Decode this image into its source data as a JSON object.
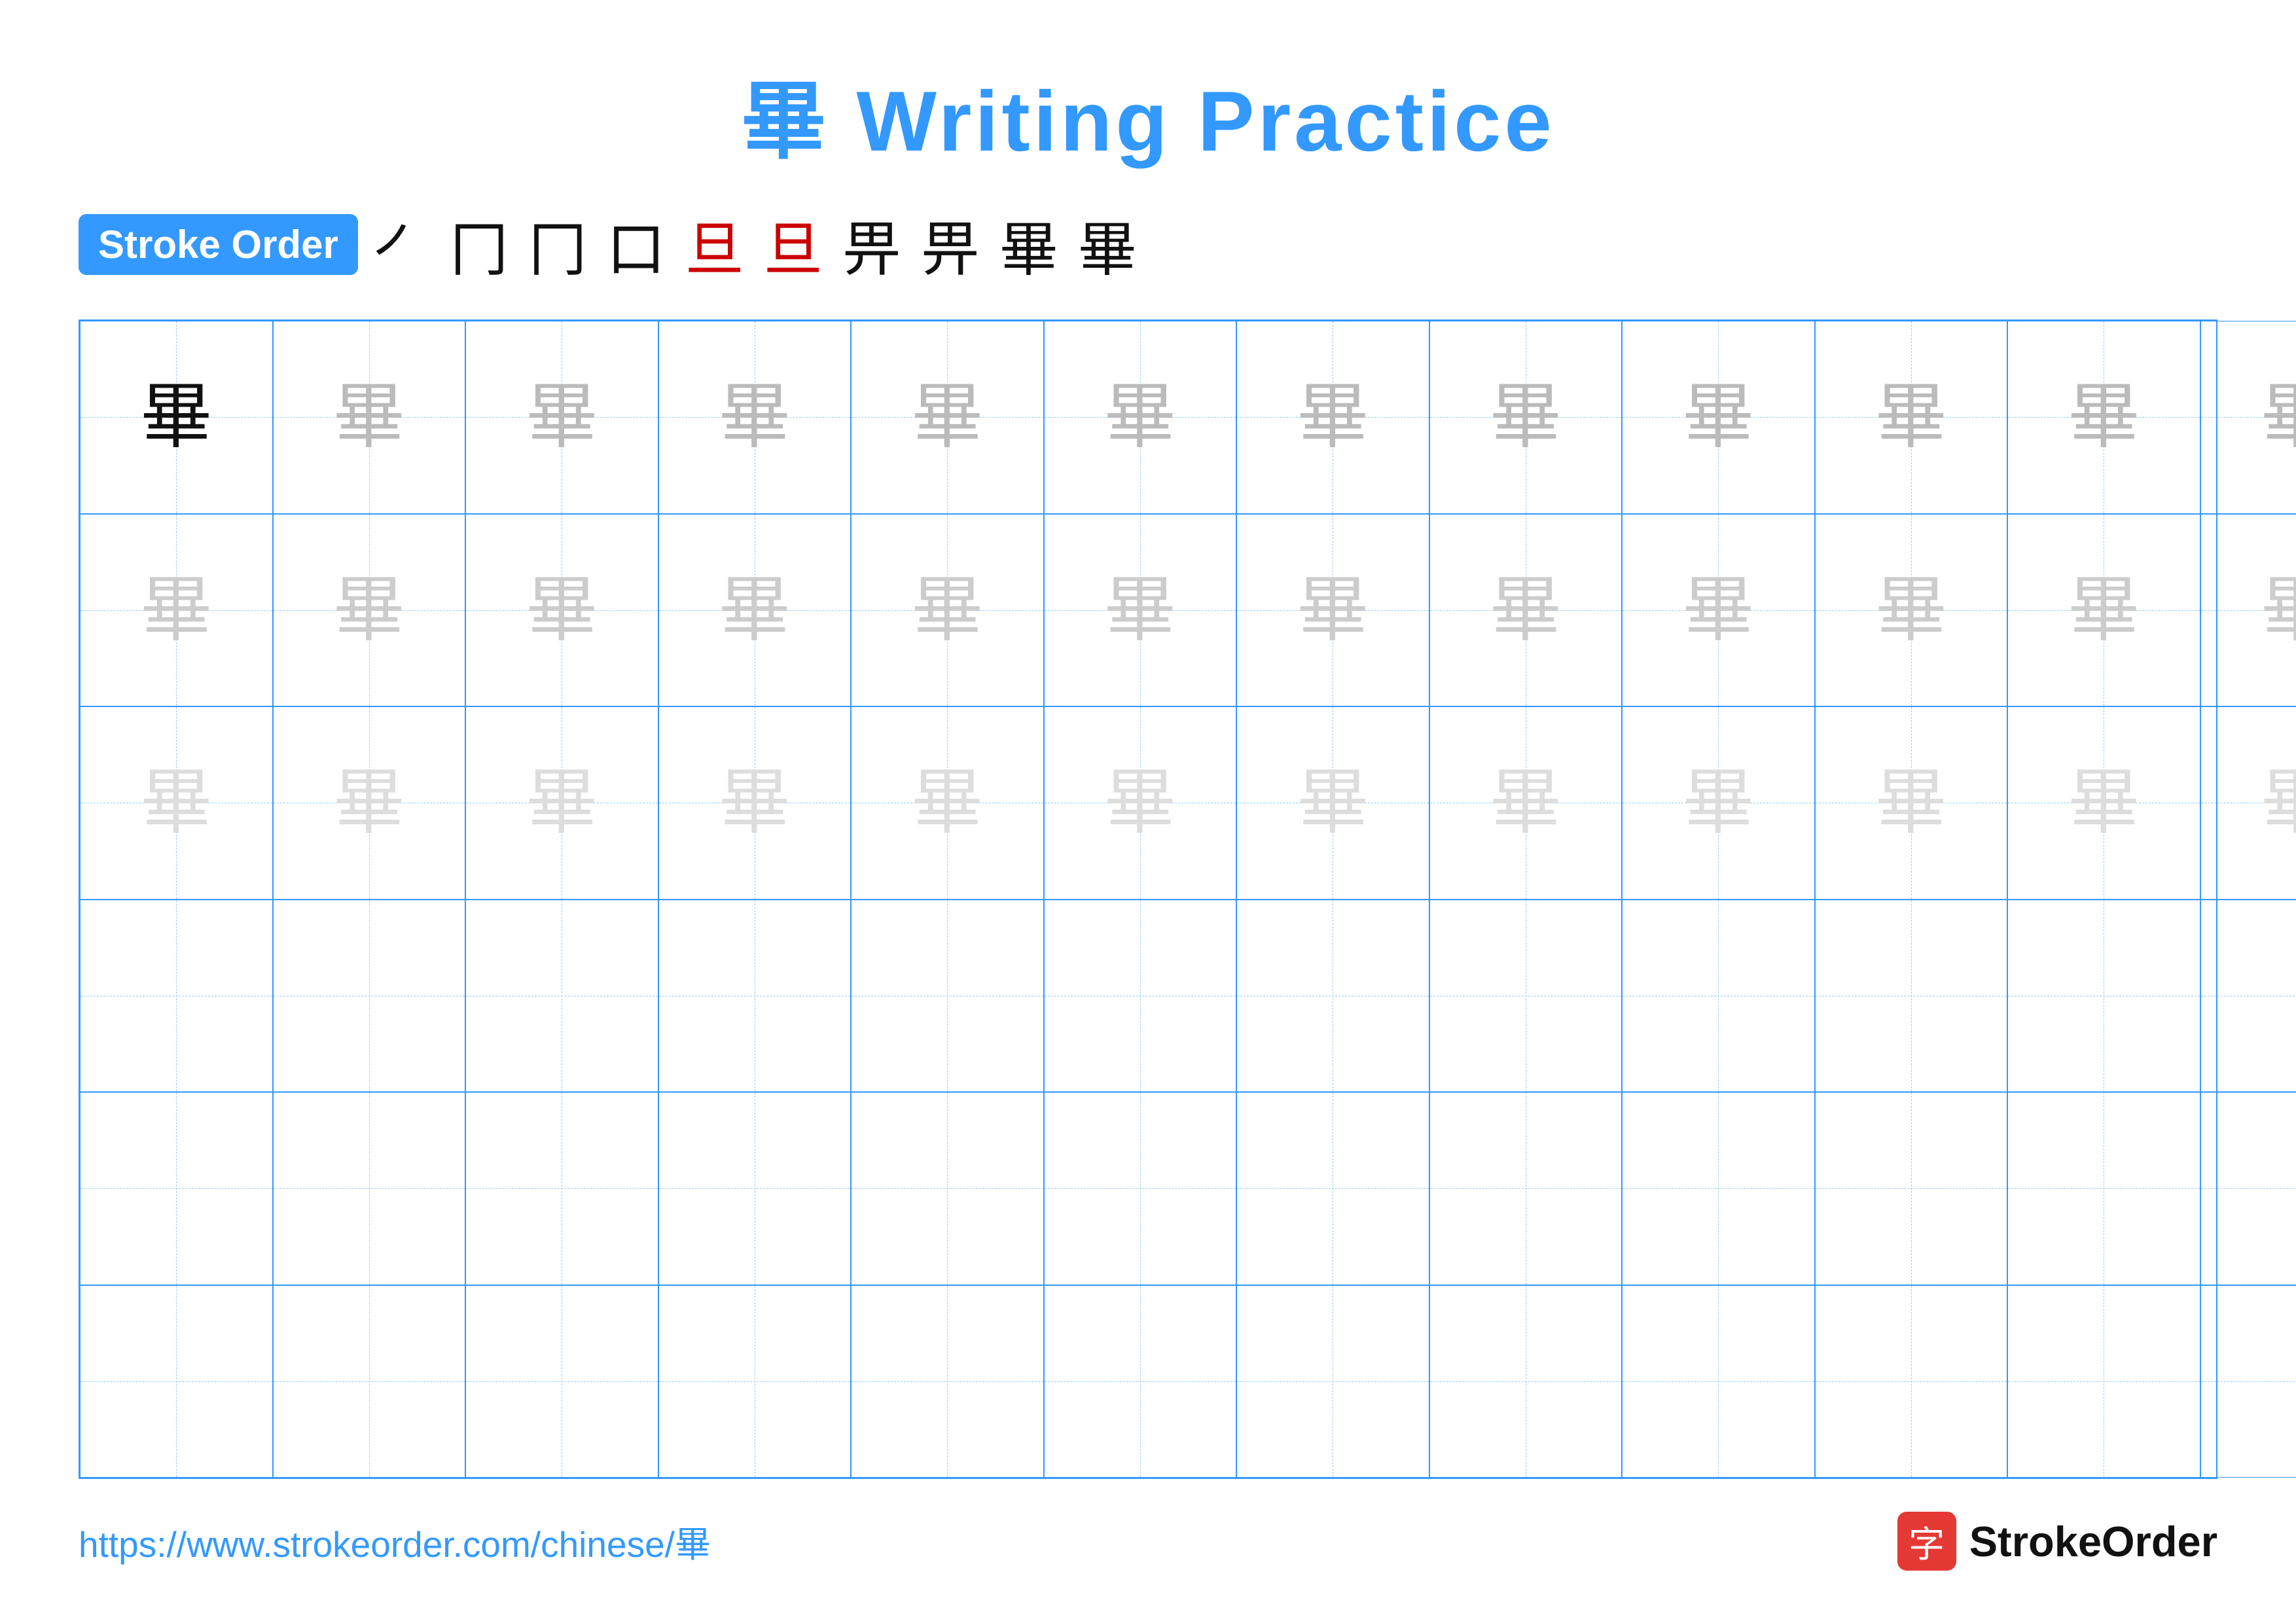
{
  "title": {
    "chinese_char": "畢",
    "rest": " Writing Practice"
  },
  "stroke_order": {
    "badge_label": "Stroke Order",
    "sequence": [
      {
        "char": "㇒",
        "style": "normal"
      },
      {
        "char": "𠃍",
        "style": "normal"
      },
      {
        "char": "冂",
        "style": "normal"
      },
      {
        "char": "口",
        "style": "normal"
      },
      {
        "char": "旦",
        "style": "red"
      },
      {
        "char": "旦",
        "style": "red"
      },
      {
        "char": "畀",
        "style": "normal"
      },
      {
        "char": "畀",
        "style": "normal"
      },
      {
        "char": "畢",
        "style": "normal"
      },
      {
        "char": "畢",
        "style": "normal"
      }
    ]
  },
  "grid": {
    "cols": 13,
    "rows": 6,
    "character": "畢",
    "cells": [
      {
        "row": 0,
        "col": 0,
        "shade": "dark"
      },
      {
        "row": 0,
        "col": 1,
        "shade": "medium"
      },
      {
        "row": 0,
        "col": 2,
        "shade": "medium"
      },
      {
        "row": 0,
        "col": 3,
        "shade": "medium"
      },
      {
        "row": 0,
        "col": 4,
        "shade": "medium"
      },
      {
        "row": 0,
        "col": 5,
        "shade": "medium"
      },
      {
        "row": 0,
        "col": 6,
        "shade": "medium"
      },
      {
        "row": 0,
        "col": 7,
        "shade": "medium"
      },
      {
        "row": 0,
        "col": 8,
        "shade": "medium"
      },
      {
        "row": 0,
        "col": 9,
        "shade": "medium"
      },
      {
        "row": 0,
        "col": 10,
        "shade": "medium"
      },
      {
        "row": 0,
        "col": 11,
        "shade": "medium"
      },
      {
        "row": 0,
        "col": 12,
        "shade": "medium"
      },
      {
        "row": 1,
        "col": 0,
        "shade": "light"
      },
      {
        "row": 1,
        "col": 1,
        "shade": "light"
      },
      {
        "row": 1,
        "col": 2,
        "shade": "light"
      },
      {
        "row": 1,
        "col": 3,
        "shade": "light"
      },
      {
        "row": 1,
        "col": 4,
        "shade": "light"
      },
      {
        "row": 1,
        "col": 5,
        "shade": "light"
      },
      {
        "row": 1,
        "col": 6,
        "shade": "light"
      },
      {
        "row": 1,
        "col": 7,
        "shade": "light"
      },
      {
        "row": 1,
        "col": 8,
        "shade": "light"
      },
      {
        "row": 1,
        "col": 9,
        "shade": "light"
      },
      {
        "row": 1,
        "col": 10,
        "shade": "light"
      },
      {
        "row": 1,
        "col": 11,
        "shade": "light"
      },
      {
        "row": 1,
        "col": 12,
        "shade": "light"
      },
      {
        "row": 2,
        "col": 0,
        "shade": "light"
      },
      {
        "row": 2,
        "col": 1,
        "shade": "light"
      },
      {
        "row": 2,
        "col": 2,
        "shade": "light"
      },
      {
        "row": 2,
        "col": 3,
        "shade": "light"
      },
      {
        "row": 2,
        "col": 4,
        "shade": "light"
      },
      {
        "row": 2,
        "col": 5,
        "shade": "light"
      },
      {
        "row": 2,
        "col": 6,
        "shade": "light"
      },
      {
        "row": 2,
        "col": 7,
        "shade": "light"
      },
      {
        "row": 2,
        "col": 8,
        "shade": "light"
      },
      {
        "row": 2,
        "col": 9,
        "shade": "light"
      },
      {
        "row": 2,
        "col": 10,
        "shade": "light"
      },
      {
        "row": 2,
        "col": 11,
        "shade": "light"
      },
      {
        "row": 2,
        "col": 12,
        "shade": "light"
      }
    ]
  },
  "footer": {
    "url": "https://www.strokeorder.com/chinese/畢",
    "logo_char": "字",
    "logo_text": "StrokeOrder"
  },
  "colors": {
    "blue": "#3399ff",
    "red": "#cc0000",
    "dark": "#111111",
    "medium_gray": "#bbbbbb",
    "light_gray": "#dddddd"
  }
}
